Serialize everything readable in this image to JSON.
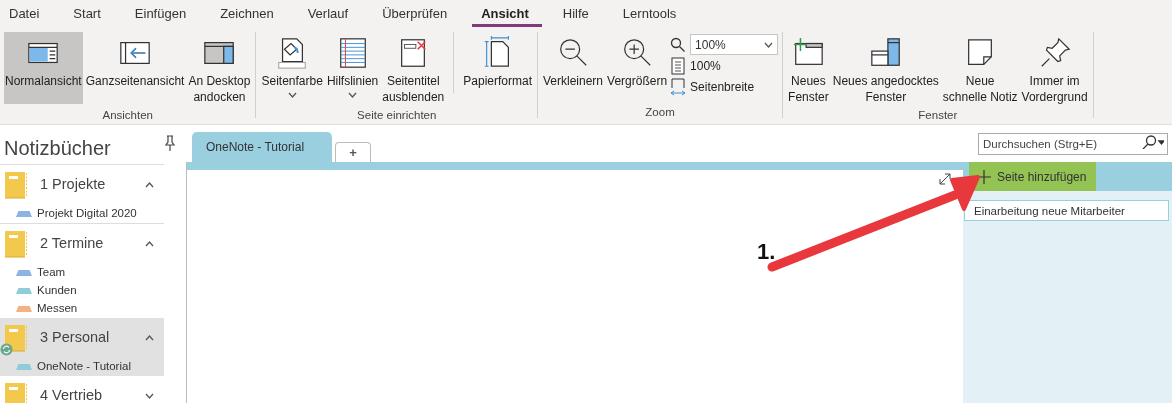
{
  "menu_tabs": [
    {
      "label": "Datei",
      "selected": false
    },
    {
      "label": "Start",
      "selected": false
    },
    {
      "label": "Einfügen",
      "selected": false
    },
    {
      "label": "Zeichnen",
      "selected": false
    },
    {
      "label": "Verlauf",
      "selected": false
    },
    {
      "label": "Überprüfen",
      "selected": false
    },
    {
      "label": "Ansicht",
      "selected": true
    },
    {
      "label": "Hilfe",
      "selected": false
    },
    {
      "label": "Lerntools",
      "selected": false
    }
  ],
  "ribbon": {
    "groups": [
      {
        "label": "Ansichten",
        "items": [
          {
            "kind": "large",
            "label": "Normalansicht",
            "selected": true
          },
          {
            "kind": "large",
            "label": "Ganzseitenansicht",
            "selected": false
          },
          {
            "kind": "large",
            "label": "An Desktop\nandocken",
            "selected": false
          }
        ]
      },
      {
        "label": "Seite einrichten",
        "items": [
          {
            "kind": "large",
            "label": "Seitenfarbe",
            "selected": false,
            "dropdown": true
          },
          {
            "kind": "large",
            "label": "Hilfslinien",
            "selected": false,
            "dropdown": true
          },
          {
            "kind": "large",
            "label": "Seitentitel\nausblenden",
            "selected": false
          },
          {
            "kind": "large",
            "label": "Papierformat",
            "selected": false,
            "divider_before": true
          }
        ]
      },
      {
        "label": "Zoom",
        "items": [
          {
            "kind": "large",
            "label": "Verkleinern",
            "selected": false
          },
          {
            "kind": "large",
            "label": "Vergrößern",
            "selected": false
          },
          {
            "kind": "combo",
            "value": "100%"
          },
          {
            "kind": "small",
            "label": "100%"
          },
          {
            "kind": "small",
            "label": "Seitenbreite"
          }
        ]
      },
      {
        "label": "Fenster",
        "items": [
          {
            "kind": "large",
            "label": "Neues\nFenster",
            "selected": false
          },
          {
            "kind": "large",
            "label": "Neues angedocktes\nFenster",
            "selected": false
          },
          {
            "kind": "large",
            "label": "Neue\nschnelle Notiz",
            "selected": false
          },
          {
            "kind": "large",
            "label": "Immer im\nVordergrund",
            "selected": false
          }
        ]
      }
    ]
  },
  "sidebar": {
    "title": "Notizbücher",
    "notebooks": [
      {
        "name": "1 Projekte",
        "expanded": true,
        "selected": false,
        "syncing": false,
        "sections": [
          {
            "name": "Projekt Digital 2020",
            "color": "#8db3e2"
          }
        ]
      },
      {
        "name": "2 Termine",
        "expanded": true,
        "selected": false,
        "syncing": false,
        "sections": [
          {
            "name": "Team",
            "color": "#8db3e2"
          },
          {
            "name": "Kunden",
            "color": "#8fcbd8"
          },
          {
            "name": "Messen",
            "color": "#f4b183"
          }
        ]
      },
      {
        "name": "3 Personal",
        "expanded": true,
        "selected": true,
        "syncing": true,
        "sections": [
          {
            "name": "OneNote - Tutorial",
            "color": "#8fcbd8"
          }
        ]
      },
      {
        "name": "4 Vertrieb",
        "expanded": false,
        "selected": false,
        "syncing": false
      }
    ]
  },
  "section_tabs": [
    {
      "label": "OneNote - Tutorial",
      "selected": true
    }
  ],
  "new_section_tab": "+",
  "search": {
    "placeholder": "Durchsuchen (Strg+E)"
  },
  "add_page_button": "Seite hinzufügen",
  "pages": [
    {
      "title": "Einarbeitung neue Mitarbeiter",
      "selected": true
    }
  ],
  "annotation": {
    "label": "1."
  }
}
